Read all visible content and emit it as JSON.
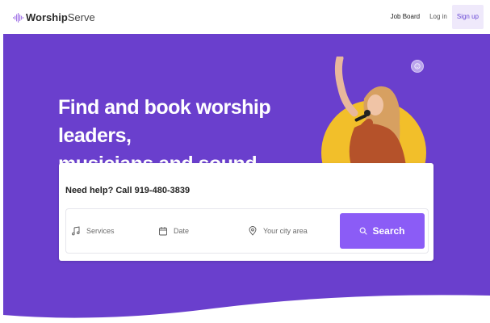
{
  "header": {
    "brand_bold": "Worship",
    "brand_light": "Serve",
    "nav": {
      "job_board": "Job Board",
      "login": "Log in",
      "signup": "Sign up"
    }
  },
  "hero": {
    "headline_line1": "Find and book worship leaders,",
    "headline_line2": "musicians and sound engineers."
  },
  "search": {
    "help_text": "Need help? Call 919-480-3839",
    "services_placeholder": "Services",
    "date_placeholder": "Date",
    "city_placeholder": "Your city area",
    "button_label": "Search"
  },
  "colors": {
    "brand_purple": "#6a3fcd",
    "accent_purple": "#8b5cf6",
    "sun_yellow": "#f2bf2a"
  },
  "icons": [
    "waveform-logo-icon",
    "music-note-icon",
    "calendar-icon",
    "map-pin-icon",
    "search-icon",
    "smiley-badge-icon"
  ]
}
